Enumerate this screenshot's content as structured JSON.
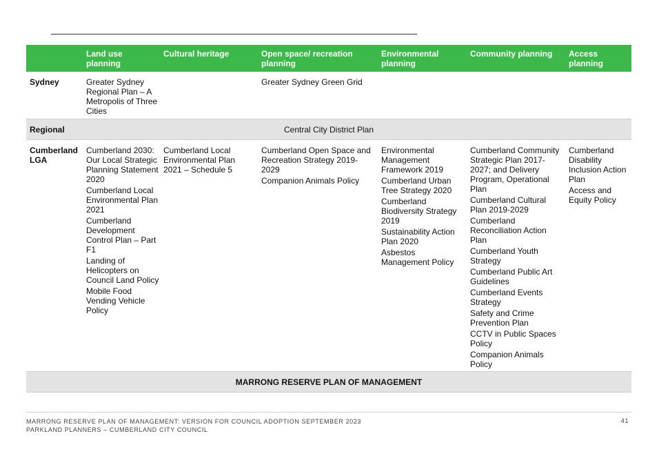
{
  "headers": [
    "Land use planning",
    "Cultural heritage",
    "Open space/ recreation planning",
    "Environmental planning",
    "Community planning",
    "Access planning"
  ],
  "rows": {
    "sydney": {
      "label": "Sydney",
      "land_use": [
        "Greater Sydney Regional Plan – A Metropolis of Three Cities"
      ],
      "open_space": [
        "Greater Sydney Green Grid"
      ]
    },
    "regional": {
      "label": "Regional",
      "text": "Central City District Plan"
    },
    "lga": {
      "label": "Cumberland LGA",
      "land_use": [
        "Cumberland 2030: Our Local Strategic Planning Statement 2020",
        "Cumberland Local Environmental Plan 2021",
        "Cumberland Development Control Plan – Part F1",
        "Landing of Helicopters on Council Land Policy",
        "Mobile Food Vending Vehicle Policy"
      ],
      "cultural": [
        "Cumberland Local Environmental Plan 2021 – Schedule 5"
      ],
      "open_space": [
        "Cumberland Open Space and Recreation Strategy 2019-2029",
        "Companion Animals Policy"
      ],
      "environmental": [
        "Environmental Management Framework 2019",
        "Cumberland Urban Tree Strategy 2020",
        "Cumberland Biodiversity Strategy 2019",
        "Sustainability Action Plan 2020",
        "Asbestos Management Policy"
      ],
      "community": [
        "Cumberland Community Strategic Plan 2017-2027; and Delivery Program, Operational Plan",
        "Cumberland Cultural Plan 2019-2029",
        "Cumberland Reconciliation Action Plan",
        "Cumberland Youth Strategy",
        "Cumberland Public Art Guidelines",
        "Cumberland Events Strategy",
        "Safety and Crime Prevention Plan",
        "CCTV in Public Spaces Policy",
        "Companion Animals Policy"
      ],
      "access": [
        "Cumberland Disability Inclusion Action Plan",
        "Access and Equity Policy"
      ]
    }
  },
  "table_footer": "MARRONG RESERVE PLAN OF MANAGEMENT",
  "page_footer": {
    "line1": "MARRONG RESERVE PLAN OF MANAGEMENT: VERSION FOR COUNCIL ADOPTION SEPTEMBER 2023",
    "line2": "PARKLAND PLANNERS – CUMBERLAND CITY COUNCIL",
    "page_number": "41"
  },
  "colors": {
    "header_green": "#3db84a",
    "band_grey": "#e3e3e3"
  }
}
